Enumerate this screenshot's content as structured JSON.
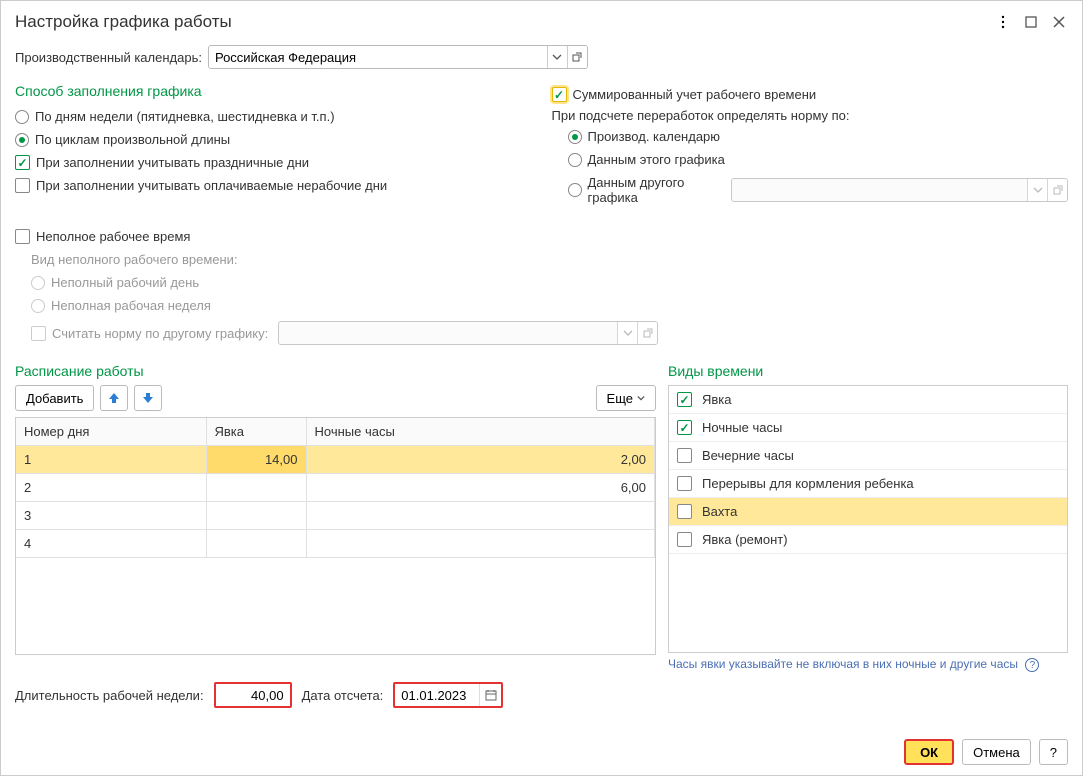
{
  "title": "Настройка графика работы",
  "calendar": {
    "label": "Производственный календарь:",
    "value": "Российская Федерация"
  },
  "fill_method": {
    "heading": "Способ заполнения графика",
    "by_days": "По дням недели (пятидневка, шестидневка и т.п.)",
    "by_cycles": "По циклам произвольной длины",
    "holidays": "При заполнении учитывать праздничные дни",
    "paid_nonwork": "При заполнении учитывать оплачиваемые нерабочие дни"
  },
  "summary": {
    "summed": "Суммированный учет рабочего времени",
    "overtime_label": "При подсчете переработок определять норму по:",
    "by_prod_calendar": "Производ. календарю",
    "by_this_schedule": "Данным этого графика",
    "by_other_schedule": "Данным другого графика"
  },
  "partial": {
    "checkbox": "Неполное рабочее время",
    "kind_label": "Вид неполного рабочего времени:",
    "partial_day": "Неполный рабочий день",
    "partial_week": "Неполная рабочая неделя",
    "norm_by_other": "Считать норму по другому графику:"
  },
  "schedule": {
    "heading": "Расписание работы",
    "add": "Добавить",
    "more": "Еще",
    "cols": {
      "daynum": "Номер дня",
      "attend": "Явка",
      "night": "Ночные часы"
    },
    "rows": [
      {
        "n": "1",
        "attend": "14,00",
        "night": "2,00"
      },
      {
        "n": "2",
        "attend": "",
        "night": "6,00"
      },
      {
        "n": "3",
        "attend": "",
        "night": ""
      },
      {
        "n": "4",
        "attend": "",
        "night": ""
      }
    ]
  },
  "timetypes": {
    "heading": "Виды времени",
    "items": [
      {
        "label": "Явка",
        "checked": true
      },
      {
        "label": "Ночные часы",
        "checked": true
      },
      {
        "label": "Вечерние часы",
        "checked": false
      },
      {
        "label": "Перерывы для кормления ребенка",
        "checked": false
      },
      {
        "label": "Вахта",
        "checked": false,
        "selected": true
      },
      {
        "label": "Явка (ремонт)",
        "checked": false
      }
    ],
    "hint": "Часы явки указывайте не включая в них ночные и другие часы"
  },
  "bottom": {
    "week_len_label": "Длительность рабочей недели:",
    "week_len": "40,00",
    "start_date_label": "Дата отсчета:",
    "start_date": "01.01.2023"
  },
  "footer": {
    "ok": "ОК",
    "cancel": "Отмена",
    "help": "?"
  }
}
